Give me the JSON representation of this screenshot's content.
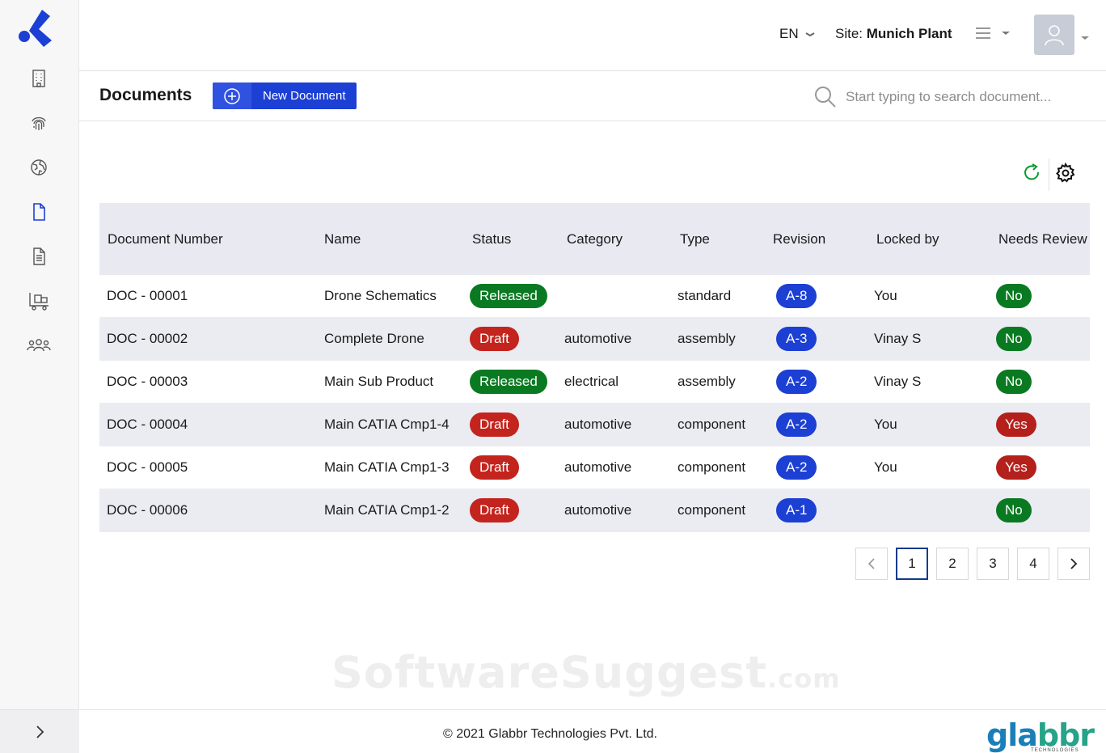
{
  "header": {
    "language": "EN",
    "site_prefix": "Site:",
    "site_name": "Munich Plant"
  },
  "sidebar": {
    "items": [
      {
        "icon": "building-icon"
      },
      {
        "icon": "fingerprint-icon"
      },
      {
        "icon": "globe-icon"
      },
      {
        "icon": "document-icon",
        "active": true
      },
      {
        "icon": "document-lines-icon"
      },
      {
        "icon": "forklift-icon"
      },
      {
        "icon": "users-icon"
      }
    ]
  },
  "page": {
    "title": "Documents",
    "new_button": "New Document",
    "search_placeholder": "Start typing to search document..."
  },
  "table": {
    "columns": [
      "Document Number",
      "Name",
      "Status",
      "Category",
      "Type",
      "Revision",
      "Locked by",
      "Needs Review"
    ],
    "rows": [
      {
        "number": "DOC - 00001",
        "name": "Drone Schematics",
        "status": "Released",
        "category": "",
        "type": "standard",
        "revision": "A-8",
        "locked_by": "You",
        "needs_review": "No"
      },
      {
        "number": "DOC - 00002",
        "name": "Complete Drone",
        "status": "Draft",
        "category": "automotive",
        "type": "assembly",
        "revision": "A-3",
        "locked_by": "Vinay S",
        "needs_review": "No"
      },
      {
        "number": "DOC - 00003",
        "name": "Main Sub Product",
        "status": "Released",
        "category": "electrical",
        "type": "assembly",
        "revision": "A-2",
        "locked_by": "Vinay S",
        "needs_review": "No"
      },
      {
        "number": "DOC - 00004",
        "name": "Main CATIA Cmp1-4",
        "status": "Draft",
        "category": "automotive",
        "type": "component",
        "revision": "A-2",
        "locked_by": "You",
        "needs_review": "Yes"
      },
      {
        "number": "DOC - 00005",
        "name": "Main CATIA Cmp1-3",
        "status": "Draft",
        "category": "automotive",
        "type": "component",
        "revision": "A-2",
        "locked_by": "You",
        "needs_review": "Yes"
      },
      {
        "number": "DOC - 00006",
        "name": "Main CATIA Cmp1-2",
        "status": "Draft",
        "category": "automotive",
        "type": "component",
        "revision": "A-1",
        "locked_by": "",
        "needs_review": "No"
      }
    ]
  },
  "pagination": {
    "pages": [
      "1",
      "2",
      "3",
      "4"
    ],
    "current": "1"
  },
  "watermark": {
    "main": "SoftwareSuggest",
    "suffix": ".com"
  },
  "footer": {
    "copyright": "© 2021 Glabbr Technologies Pvt. Ltd.",
    "brand": "glabbr",
    "brand_sub": "TECHNOLOGIES"
  },
  "colors": {
    "primary": "#1c3fd4",
    "released": "#0a7a22",
    "draft": "#c3241d",
    "refresh": "#0a9a2e"
  }
}
